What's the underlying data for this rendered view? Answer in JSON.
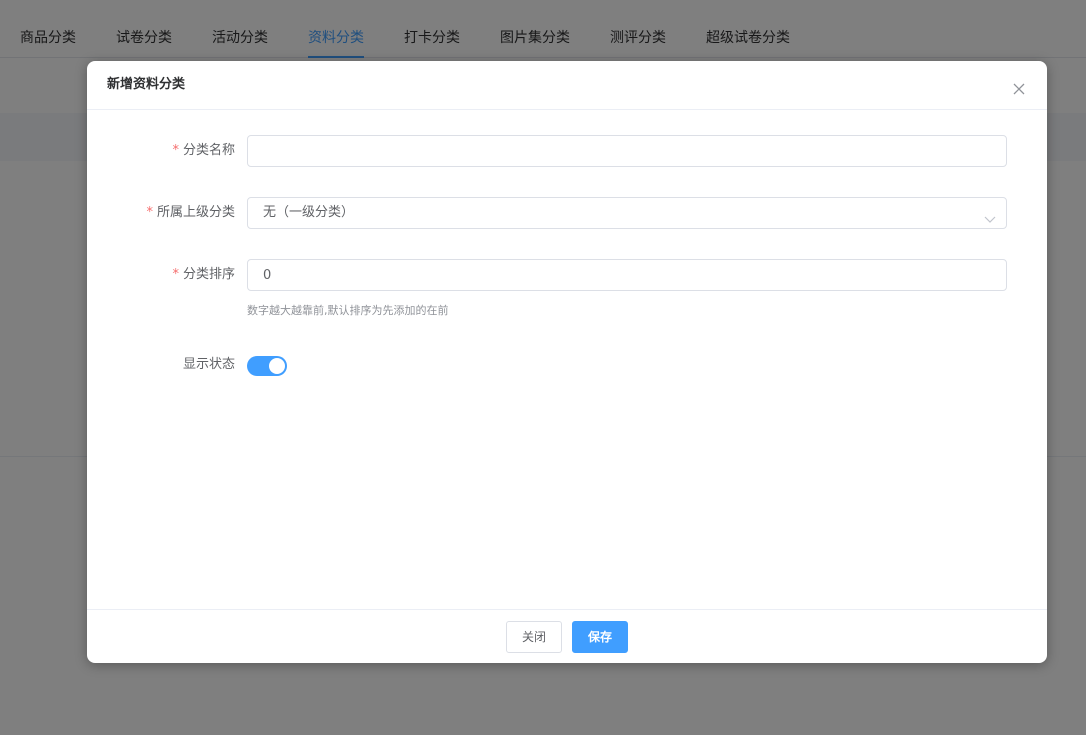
{
  "tabs": [
    {
      "label": "商品分类",
      "active": false
    },
    {
      "label": "试卷分类",
      "active": false
    },
    {
      "label": "活动分类",
      "active": false
    },
    {
      "label": "资料分类",
      "active": true
    },
    {
      "label": "打卡分类",
      "active": false
    },
    {
      "label": "图片集分类",
      "active": false
    },
    {
      "label": "测评分类",
      "active": false
    },
    {
      "label": "超级试卷分类",
      "active": false
    }
  ],
  "dialog": {
    "title": "新增资料分类",
    "close_icon": "close-icon",
    "form": {
      "required_mark": "*",
      "name_label": "分类名称",
      "name_value": "",
      "parent_label": "所属上级分类",
      "parent_value": "无（一级分类）",
      "sort_label": "分类排序",
      "sort_value": "0",
      "sort_hint": "数字越大越靠前,默认排序为先添加的在前",
      "status_label": "显示状态",
      "status_on": true
    },
    "footer": {
      "close_label": "关闭",
      "save_label": "保存"
    }
  },
  "colors": {
    "accent": "#409eff",
    "required": "#f56c6c",
    "overlay": "rgba(0,0,0,0.5)"
  }
}
